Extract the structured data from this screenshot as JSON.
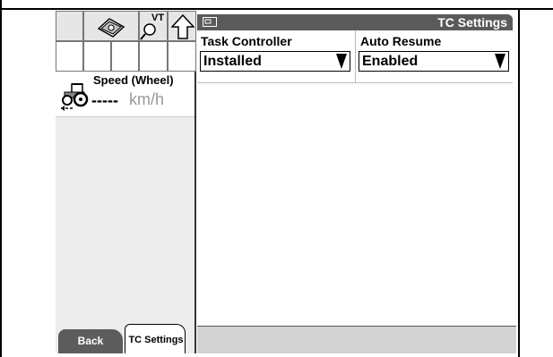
{
  "left_panel": {
    "toolbar_icons": [
      "book-icon",
      "vt-search-icon",
      "up-arrow-icon"
    ],
    "vt_badge": "VT",
    "speed": {
      "label": "Speed (Wheel)",
      "value": "-----",
      "unit": "km/h"
    }
  },
  "titlebar": {
    "title": "TC Settings",
    "icon": "screen-icon"
  },
  "settings": [
    {
      "label": "Task Controller",
      "value": "Installed"
    },
    {
      "label": "Auto Resume",
      "value": "Enabled"
    }
  ],
  "tabs": [
    {
      "label": "Back"
    },
    {
      "label": "TC Settings"
    }
  ],
  "colors": {
    "titlebar_bg": "#5a5a5a",
    "tab_back_bg": "#5c5c5c",
    "unit_text": "#999999"
  }
}
